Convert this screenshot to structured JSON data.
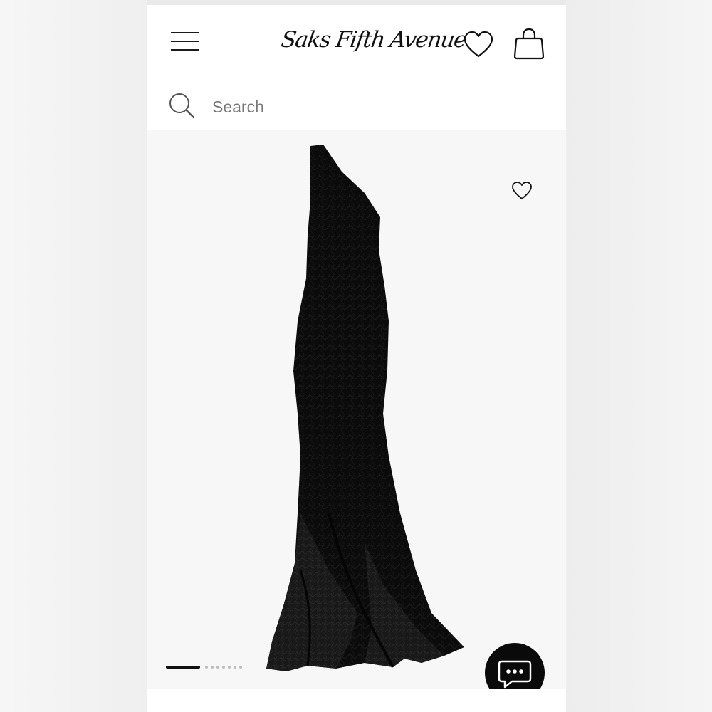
{
  "header": {
    "logo_text": "Saks Fifth Avenue",
    "menu_icon": "hamburger-menu-icon",
    "wishlist_icon": "heart-icon",
    "bag_icon": "shopping-bag-icon"
  },
  "search": {
    "placeholder": "Search",
    "value": "",
    "icon": "search-icon"
  },
  "product": {
    "image_icon": "black-one-shoulder-gown-image",
    "favorite_icon": "heart-outline-icon",
    "carousel": {
      "total": 8,
      "active_index": 0
    }
  },
  "chat": {
    "icon": "chat-bubble-icon"
  },
  "colors": {
    "background": "#ffffff",
    "text": "#111111",
    "image_bg": "#f7f7f7",
    "chat_bg": "#0a0a0a"
  }
}
